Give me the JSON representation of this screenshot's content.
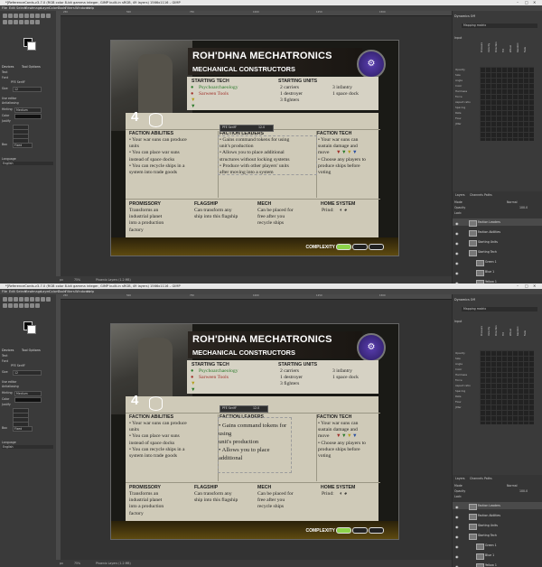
{
  "windows": [
    {
      "title": "*[ReferenceCards-v3-7.0 (RGB color 8-bit gamma integer, GIMP built-in sRGB, 49 layers) 1566x1116 – GIMP",
      "window_controls": [
        "–",
        "□",
        "✕"
      ],
      "menu": [
        "File",
        "Edit",
        "Select",
        "View",
        "Image",
        "Layer",
        "Colors",
        "Tools",
        "Filters",
        "Windows",
        "Help"
      ],
      "toolbox": {
        "tabs": [
          "Devices",
          "Tool Options"
        ],
        "tool_name": "Text",
        "font_label": "Font",
        "font_value": "PFE SerifF",
        "size_label": "Size",
        "size_value": "12",
        "use_editor": "Use editor",
        "antialiasing": "Antialiasing",
        "hinting_label": "Hinting",
        "hinting_value": "Medium",
        "color_label": "Color",
        "justify_label": "Justify",
        "box_label": "Box",
        "box_value": "Fixed",
        "language_label": "Language",
        "language_value": "English"
      },
      "ruler_ticks": [
        "250",
        "500",
        "750",
        "1000",
        "1250",
        "1500"
      ],
      "status": {
        "unit": "px",
        "zoom": "75%",
        "info": "Phoenix Layers (1.2 MB)"
      },
      "editor_overflow": false
    },
    {
      "title": "*[ReferenceCards-v3-7.0 (RGB color 8-bit gamma integer, GIMP built-in sRGB, 49 layers) 1566x1116 – GIMP",
      "window_controls": [
        "–",
        "□",
        "✕"
      ],
      "menu": [
        "File",
        "Edit",
        "Select",
        "View",
        "Image",
        "Layer",
        "Colors",
        "Tools",
        "Filters",
        "Windows",
        "Help"
      ],
      "toolbox": {
        "tabs": [
          "Devices",
          "Tool Options"
        ],
        "tool_name": "Text",
        "font_label": "Font",
        "font_value": "PFE SerifF",
        "size_label": "Size",
        "size_value": "12",
        "use_editor": "Use editor",
        "antialiasing": "Antialiasing",
        "hinting_label": "Hinting",
        "hinting_value": "Medium",
        "color_label": "Color",
        "justify_label": "Justify",
        "box_label": "Box",
        "box_value": "Fixed",
        "language_label": "Language",
        "language_value": "English"
      },
      "ruler_ticks": [
        "250",
        "500",
        "750",
        "1000",
        "1250",
        "1500"
      ],
      "status": {
        "unit": "px",
        "zoom": "75%",
        "info": "Phoenix Layers (1.2 MB)"
      },
      "editor_overflow": true
    }
  ],
  "card": {
    "name": "ROH'DHNA MECHATRONICS",
    "subtitle": "MECHANICAL CONSTRUCTORS",
    "commodities": "4",
    "starting_tech_heading": "STARTING TECH",
    "starting_tech": [
      "Psychoarchaeology",
      "Sarween Tools"
    ],
    "starting_units_heading": "STARTING UNITS",
    "starting_units_col1": [
      "2 carriers",
      "1 destroyer",
      "3 fighters"
    ],
    "starting_units_col2": [
      "3 infantry",
      "1 space dock"
    ],
    "faction_abilities_heading": "FACTION ABILITIES",
    "faction_abilities": [
      "• Your war suns can produce",
      "  units",
      "• You can place war suns",
      "  instead of space docks",
      "• You can recycle ships in a",
      "  system into trade goods"
    ],
    "faction_leaders_heading": "FACTION LEADERS",
    "faction_leaders": [
      "• Gains command tokens for using",
      "  unit's production",
      "• Allows you to place additional",
      "  structures without locking systems",
      "• Produce with other players' units",
      "  after moving into a system"
    ],
    "faction_leaders_overflow": [
      "• Gains command tokens for",
      "using",
      " unit's production",
      "• Allows you to place",
      " additional"
    ],
    "faction_tech_heading": "FACTION TECH",
    "faction_tech": [
      "• Your war suns can",
      "  sustain damage and",
      "  move",
      "• Choose any players to",
      "  produce ships before",
      "  voting"
    ],
    "promissory_heading": "PROMISSORY",
    "promissory": [
      "Transforms an",
      "industrial planet",
      "into a production",
      "factory"
    ],
    "flagship_heading": "FLAGSHIP",
    "flagship": [
      "Can transform any",
      "ship into this flagship"
    ],
    "mech_heading": "MECH",
    "mech": [
      "Can be placed for",
      "free after you",
      "recycle ships"
    ],
    "home_heading": "HOME SYSTEM",
    "home": "Prind:",
    "complexity": "COMPLEXITY",
    "complexity_level": 1,
    "text_toolbar_font": "PFE SerifF",
    "text_toolbar_size": "12.0"
  },
  "right_panel": {
    "tab": "Dynamics Off",
    "dynamics_value": "Mapping matrix",
    "input_label": "Input",
    "axes": [
      "Pressure",
      "Velocity",
      "Direction",
      "Tilt",
      "Wheel",
      "Random",
      "Fade"
    ],
    "rows": [
      "Opacity",
      "Size",
      "Angle",
      "Color",
      "Hardness",
      "Force",
      "Aspect ratio",
      "Spacing",
      "Rate",
      "Flow",
      "Jitter"
    ],
    "layer_tabs": [
      "Layers",
      "Channels",
      "Paths"
    ],
    "mode_label": "Mode",
    "mode_value": "Normal",
    "opacity_label": "Opacity",
    "opacity_value": "100.0",
    "lock_label": "Lock:",
    "layers": [
      "Faction Leaders",
      "Faction Abilities",
      "Starting Units",
      "Starting Tech",
      "Green 1",
      "Blue 1",
      "Yellow 1"
    ]
  },
  "colors": {
    "accent_green": "#8cd34a",
    "panel": "#d6d2c4",
    "gold": "#b59a34"
  }
}
